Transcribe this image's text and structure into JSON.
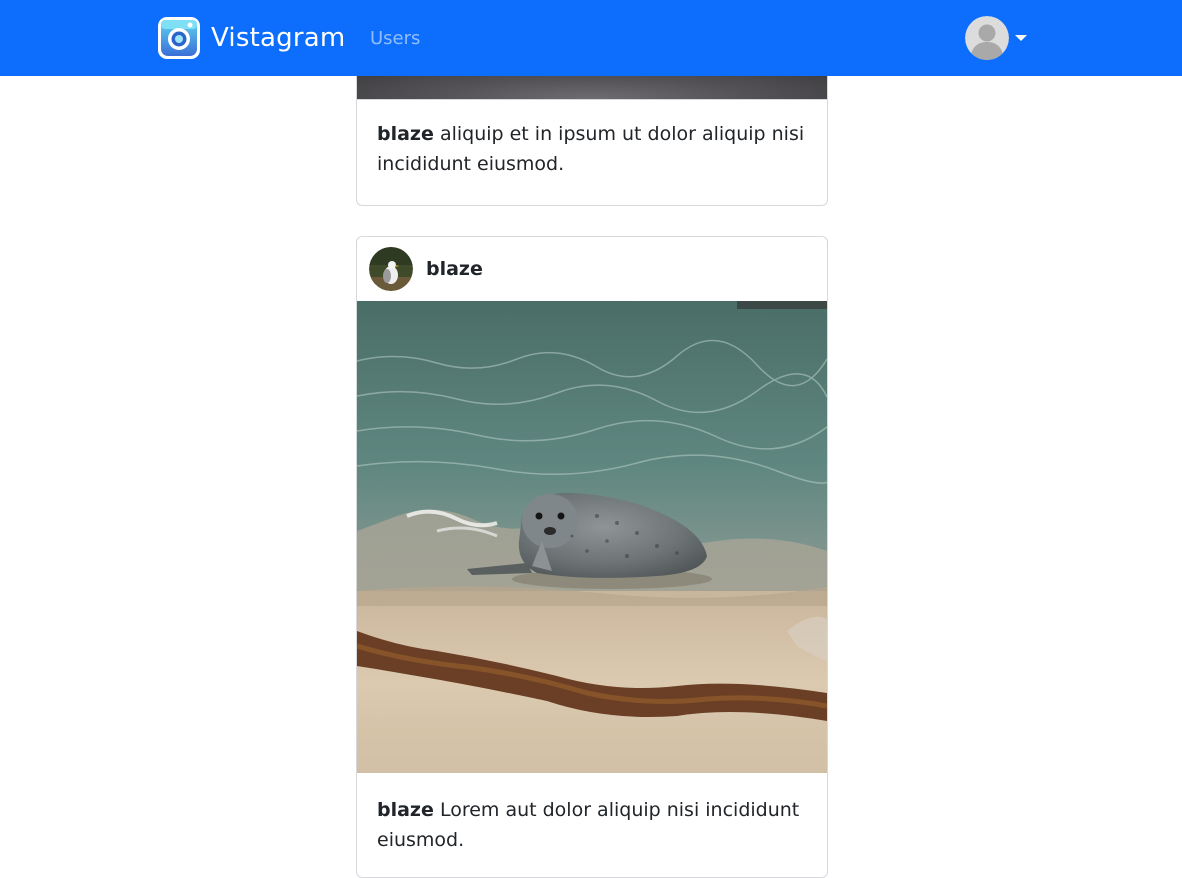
{
  "navbar": {
    "brand": "Vistagram",
    "links": [
      {
        "label": "Users"
      }
    ],
    "user_menu": {
      "avatar_icon": "user-avatar-icon",
      "caret_icon": "caret-down-icon"
    }
  },
  "colors": {
    "navbar_bg": "#0d6efd",
    "nav_link": "rgba(255,255,255,0.55)",
    "card_border": "#d6d8db"
  },
  "feed": {
    "posts": [
      {
        "username": "blaze",
        "caption": "aliquip et in ipsum ut dolor aliquip nisi incididunt eiusmod."
      },
      {
        "username": "blaze",
        "avatar": "seagull photo",
        "image": "harbor seal on beach",
        "caption": "Lorem aut dolor aliquip nisi incididunt eiusmod."
      }
    ]
  }
}
